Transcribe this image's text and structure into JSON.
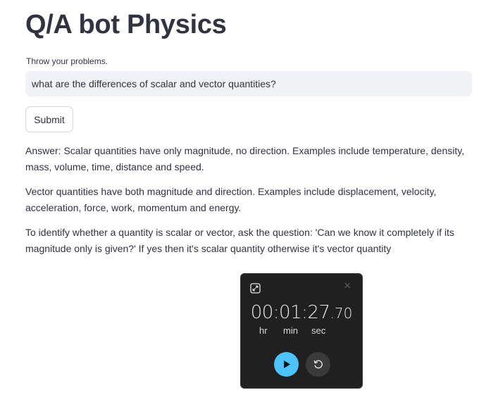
{
  "page": {
    "title": "Q/A bot Physics"
  },
  "question": {
    "label": "Throw your problems.",
    "value": "what are the differences of scalar and vector quantities?"
  },
  "submit_label": "Submit",
  "answer": {
    "paragraphs": [
      "Answer: Scalar quantities have only magnitude, no direction. Examples include temperature, density, mass, volume, time, distance and speed.",
      "Vector quantities have both magnitude and direction. Examples include displacement, velocity, acceleration, force, work, momentum and energy.",
      "To identify whether a quantity is scalar or vector, ask the question: 'Can we know it completely if its magnitude only is given?' If yes then it's scalar quantity otherwise it's vector quantity"
    ]
  },
  "timer_widget": {
    "time_main": "00:01:27",
    "time_fraction": ".70",
    "units": [
      "hr",
      "min",
      "sec"
    ],
    "close_glyph": "×",
    "icons": {
      "expand": "expand-icon",
      "close": "close-icon",
      "play": "play-icon",
      "reset": "reset-icon"
    },
    "colors": {
      "background": "#202020",
      "play_accent": "#4cc2ff"
    }
  }
}
